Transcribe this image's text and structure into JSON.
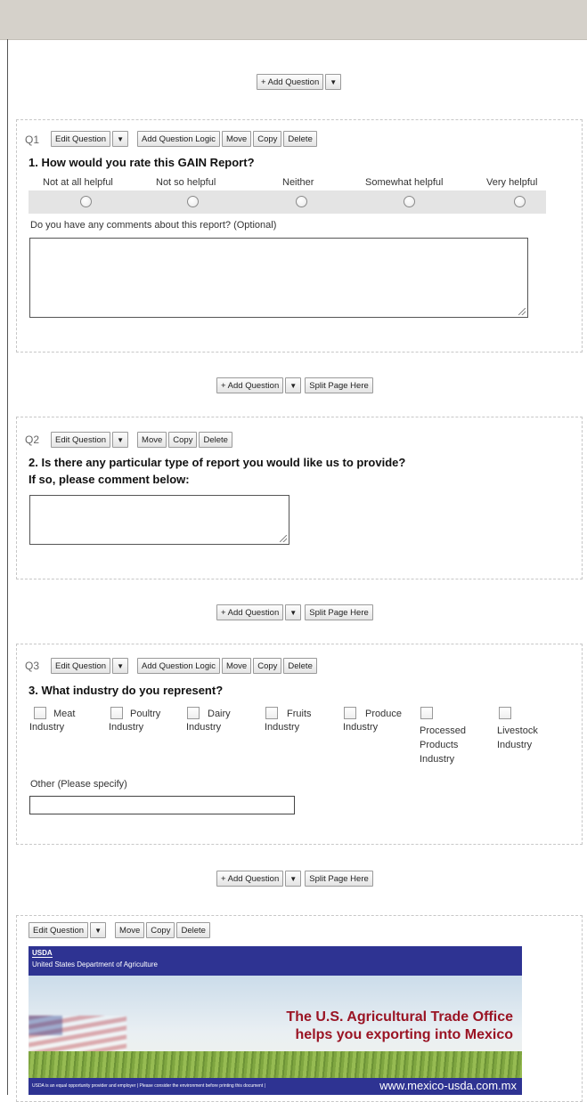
{
  "controls": {
    "add_question": "+ Add Question",
    "dropdown_arrow": "▼",
    "split_page": "Split Page Here",
    "edit_question": "Edit Question",
    "add_logic": "Add Question Logic",
    "move": "Move",
    "copy": "Copy",
    "delete": "Delete"
  },
  "q1": {
    "number": "Q1",
    "title": "1. How would you rate this GAIN Report?",
    "scale": [
      "Not at all helpful",
      "Not so helpful",
      "Neither",
      "Somewhat helpful",
      "Very helpful"
    ],
    "comment_label": "Do you have any comments about this report? (Optional)"
  },
  "q2": {
    "number": "Q2",
    "title_line1": "2. Is there any particular type of report you would like us to provide?",
    "title_line2": "If so, please comment below:"
  },
  "q3": {
    "number": "Q3",
    "title": "3. What industry do you represent?",
    "options": [
      [
        "Meat",
        "Industry"
      ],
      [
        "Poultry",
        "Industry"
      ],
      [
        "Dairy",
        "Industry"
      ],
      [
        "Fruits",
        "Industry"
      ],
      [
        "Produce",
        "Industry"
      ],
      [
        "Processed",
        "Products",
        "Industry"
      ],
      [
        "Livestock",
        "Industry"
      ]
    ],
    "other_label": "Other (Please specify)"
  },
  "banner": {
    "logo": "USDA",
    "agency": "United States Department of Agriculture",
    "headline_line1": "The U.S. Agricultural Trade Office",
    "headline_line2": "helps you exporting into Mexico",
    "footer_note": "USDA is an equal opportunity provider and employer  |  Please consider the environment before printing this document  |",
    "url": "www.mexico-usda.com.mx"
  }
}
